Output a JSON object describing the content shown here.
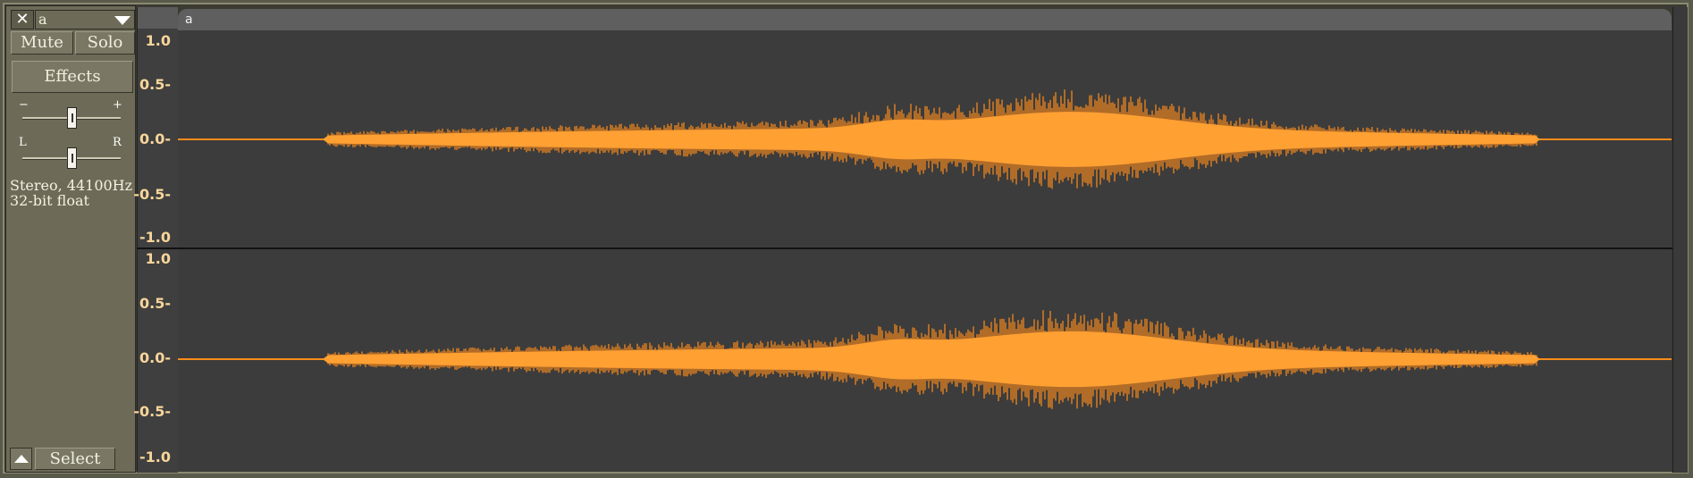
{
  "track": {
    "close_glyph": "✕",
    "name": "a",
    "mute_label": "Mute",
    "solo_label": "Solo",
    "effects_label": "Effects",
    "gain_minus": "−",
    "gain_plus": "+",
    "gain_level": 0.5,
    "pan_left": "L",
    "pan_right": "R",
    "pan_level": 0.5,
    "info_line1": "Stereo, 44100Hz",
    "info_line2": "32-bit float",
    "select_label": "Select",
    "collapse_icon": "triangle-up-icon"
  },
  "clip": {
    "name": "a"
  },
  "ruler": {
    "ticks": [
      "1.0",
      "0.5-",
      "0.0-",
      "-0.5-",
      "-1.0"
    ]
  },
  "colors": {
    "waveform_rms": "#ffa033",
    "waveform_peak": "#ff8c1a",
    "background": "#3c3c3c",
    "panel": "#6d6b57",
    "ruler_text": "#f7d59a"
  }
}
